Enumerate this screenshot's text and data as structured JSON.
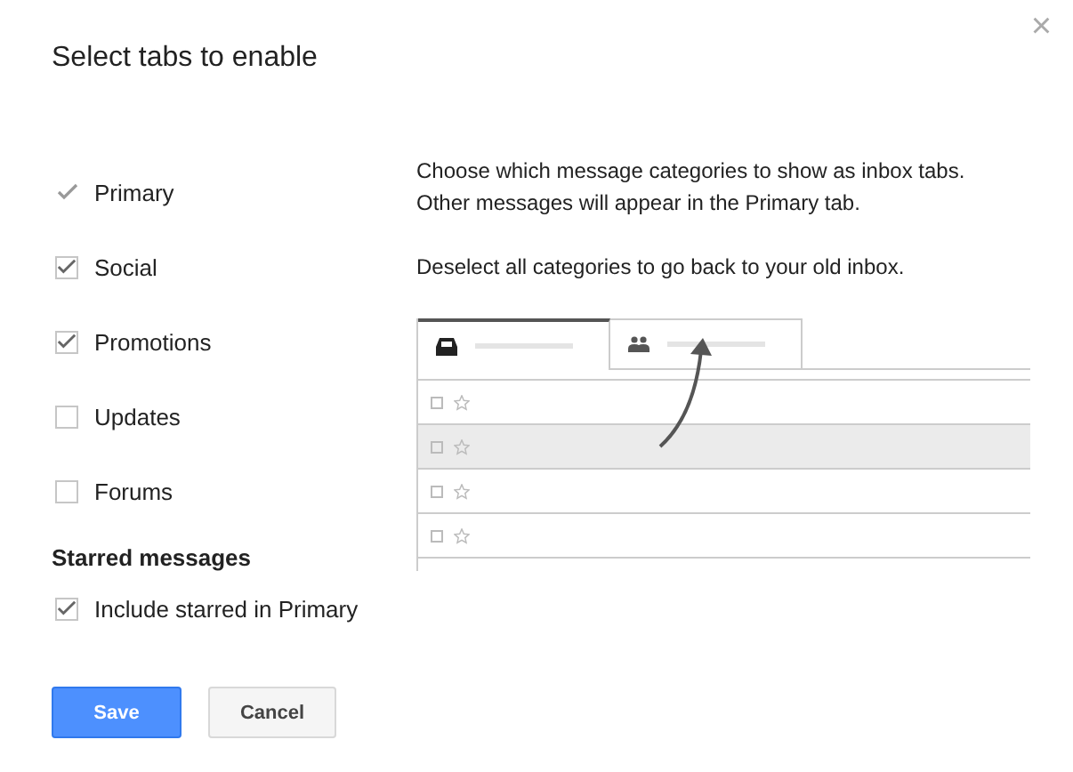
{
  "dialog": {
    "title": "Select tabs to enable",
    "close": "×"
  },
  "categories": [
    {
      "label": "Primary",
      "checked": true,
      "disabled": true
    },
    {
      "label": "Social",
      "checked": true,
      "disabled": false
    },
    {
      "label": "Promotions",
      "checked": true,
      "disabled": false
    },
    {
      "label": "Updates",
      "checked": false,
      "disabled": false
    },
    {
      "label": "Forums",
      "checked": false,
      "disabled": false
    }
  ],
  "starred": {
    "heading": "Starred messages",
    "label": "Include starred in Primary",
    "checked": true
  },
  "description": [
    "Choose which message categories to show as inbox tabs.\nOther messages will appear in the Primary tab.",
    "Deselect all categories to go back to your old inbox."
  ],
  "preview": {
    "tabs": [
      {
        "kind": "inbox",
        "selected": true
      },
      {
        "kind": "people",
        "selected": false
      }
    ],
    "rows": [
      {
        "highlighted": false
      },
      {
        "highlighted": true
      },
      {
        "highlighted": false
      },
      {
        "highlighted": false
      }
    ]
  },
  "buttons": [
    {
      "label": "Save",
      "kind": "primary"
    },
    {
      "label": "Cancel",
      "kind": "secondary"
    }
  ]
}
